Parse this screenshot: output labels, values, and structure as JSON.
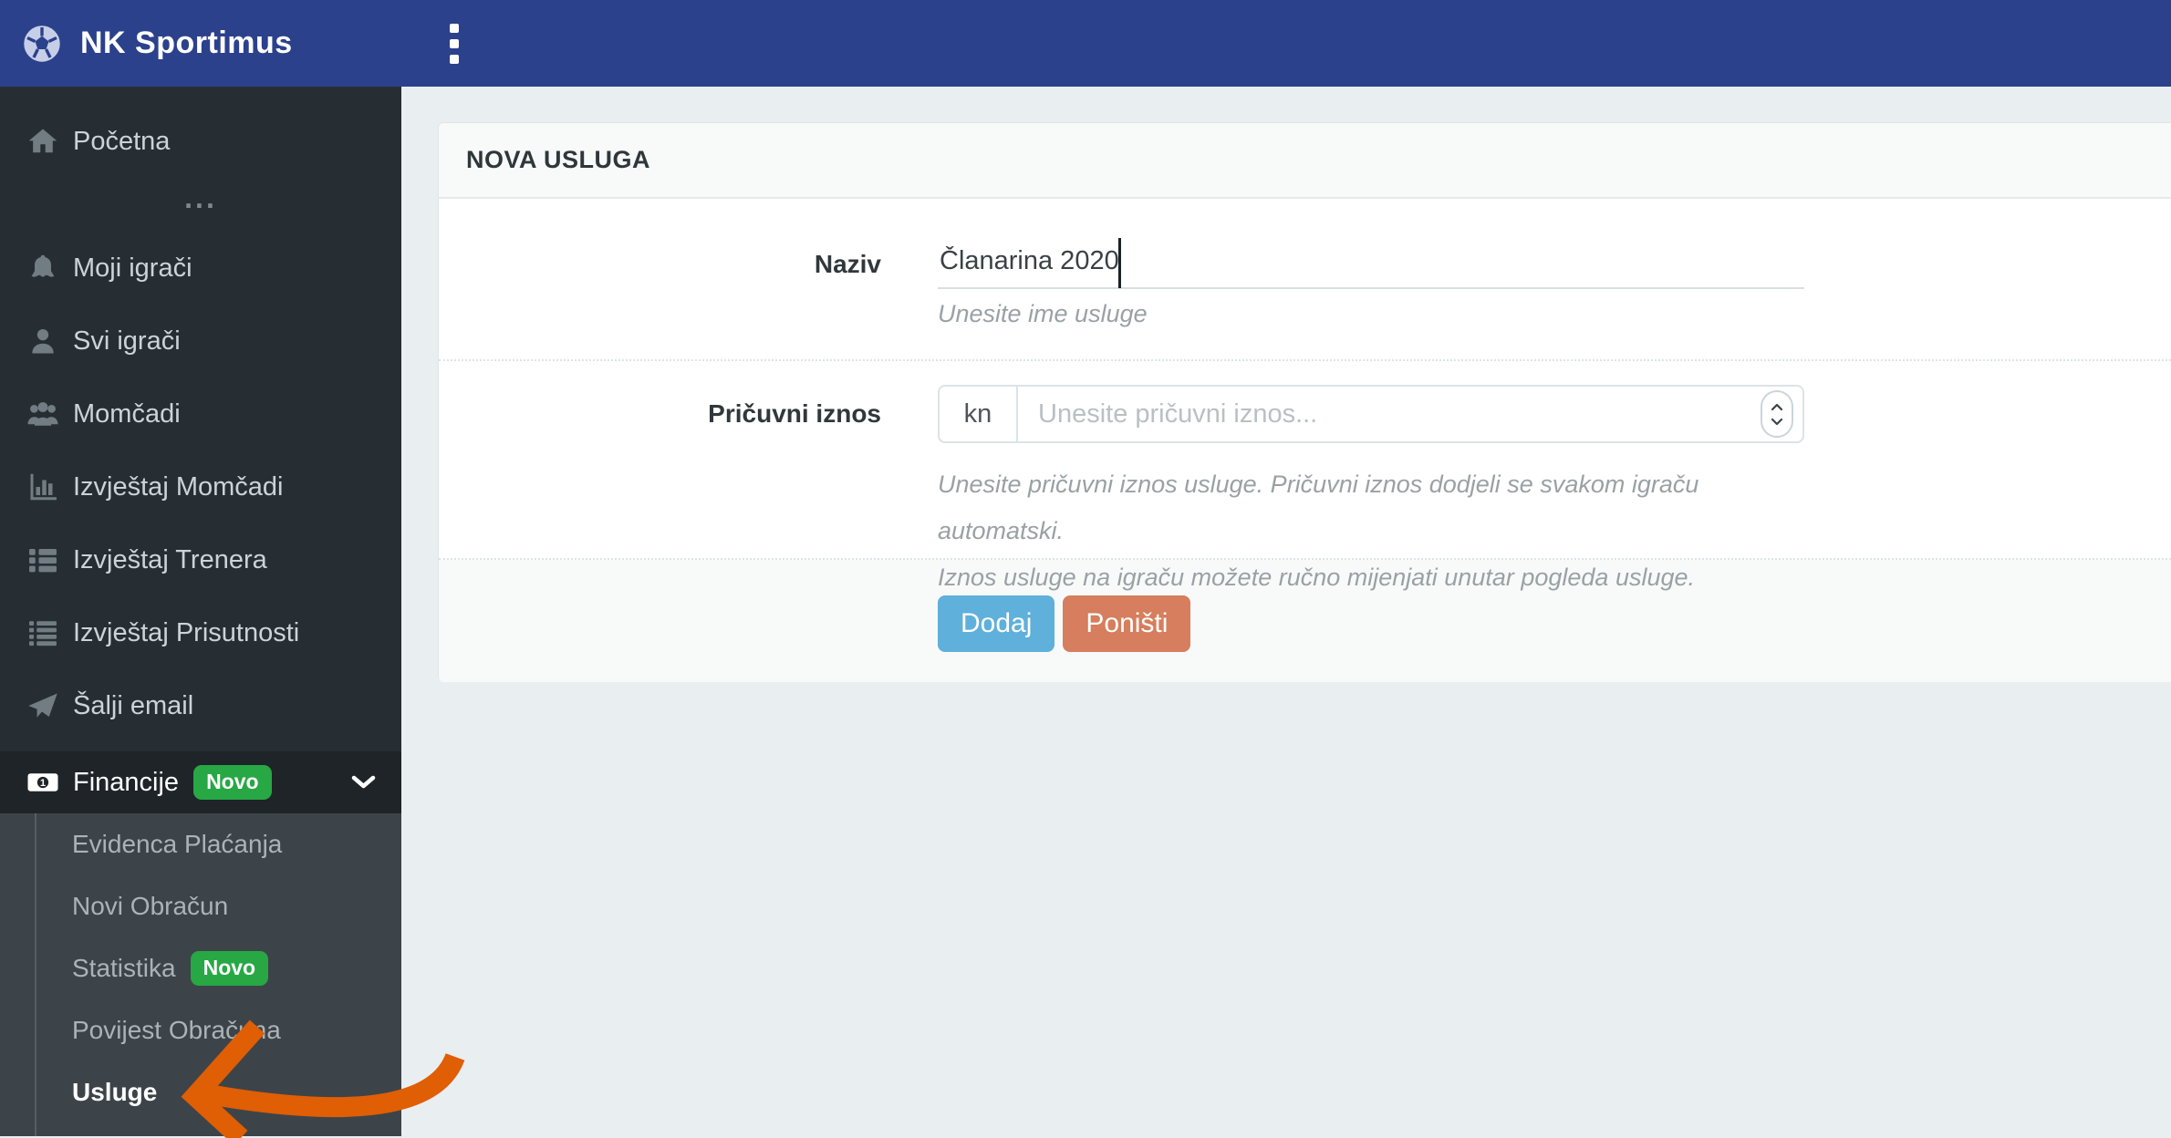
{
  "navbar": {
    "brand": "NK Sportimus"
  },
  "sidebar": {
    "divider": "...",
    "items": [
      {
        "label": "Početna",
        "icon": "home-icon"
      },
      {
        "label": "Moji igrači",
        "icon": "bell-icon"
      },
      {
        "label": "Svi igrači",
        "icon": "user-icon"
      },
      {
        "label": "Momčadi",
        "icon": "users-icon"
      },
      {
        "label": "Izvještaj Momčadi",
        "icon": "bar-chart-icon"
      },
      {
        "label": "Izvještaj Trenera",
        "icon": "list-icon"
      },
      {
        "label": "Izvještaj Prisutnosti",
        "icon": "list-dense-icon"
      },
      {
        "label": "Šalji email",
        "icon": "paper-plane-icon"
      },
      {
        "label": "Financije",
        "icon": "money-icon",
        "badge": "Novo"
      }
    ],
    "submenu": [
      {
        "label": "Evidenca Plaćanja"
      },
      {
        "label": "Novi Obračun"
      },
      {
        "label": "Statistika",
        "badge": "Novo"
      },
      {
        "label": "Povijest Obračuna"
      },
      {
        "label": "Usluge"
      }
    ]
  },
  "form": {
    "title": "NOVA USLUGA",
    "naziv_label": "Naziv",
    "naziv_value": "Članarina 2020",
    "naziv_helper": "Unesite ime usluge",
    "iznos_label": "Pričuvni iznos",
    "iznos_prefix": "kn",
    "iznos_placeholder": "Unesite pričuvni iznos...",
    "iznos_helper_1": "Unesite pričuvni iznos usluge. Pričuvni iznos dodjeli se svakom igraču automatski.",
    "iznos_helper_2": "Iznos usluge na igraču možete ručno mijenjati unutar pogleda usluge.",
    "submit_label": "Dodaj",
    "cancel_label": "Poništi"
  },
  "colors": {
    "navbar_blue": "#2b418c",
    "sidebar_bg": "#272e33",
    "page_bg": "#e9eef1",
    "badge_green": "#28a745",
    "submit_blue": "#5fb0db",
    "cancel_orange": "#d67e5d",
    "arrow_orange": "#e05e04"
  }
}
